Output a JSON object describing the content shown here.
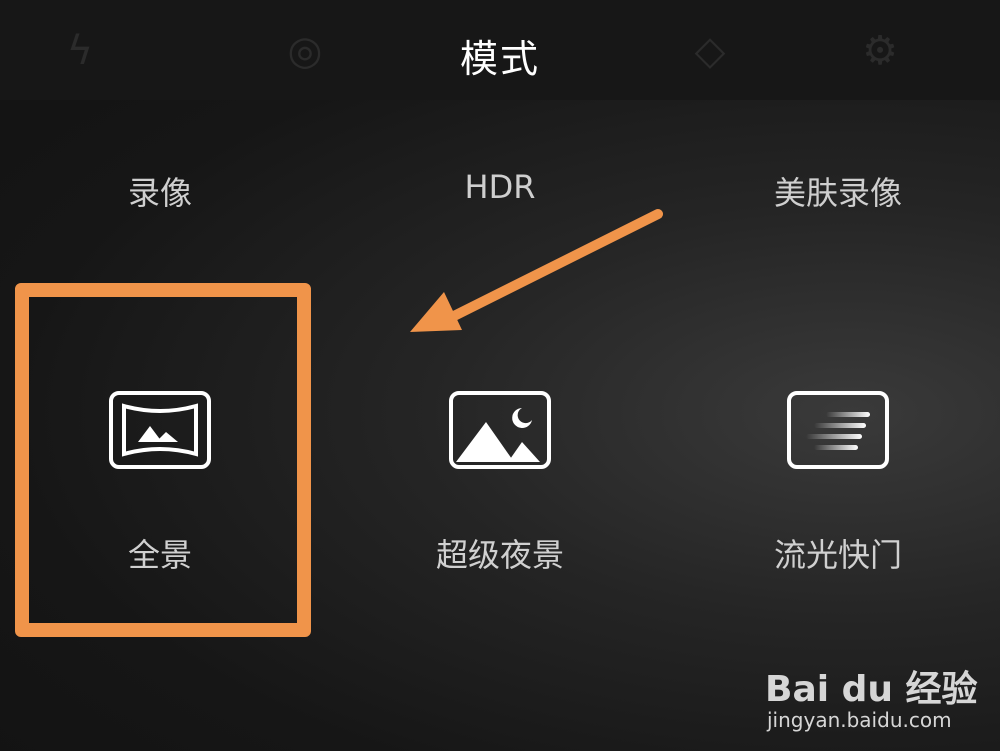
{
  "header": {
    "title": "模式",
    "background_icons": [
      "flash-icon",
      "timer-icon",
      "filter-icon",
      "settings-icon"
    ]
  },
  "modes_row1": [
    {
      "label": "录像"
    },
    {
      "label": "HDR"
    },
    {
      "label": "美肤录像"
    }
  ],
  "modes_row2": [
    {
      "label": "全景",
      "icon": "panorama-icon",
      "highlighted": true
    },
    {
      "label": "超级夜景",
      "icon": "night-scene-icon",
      "highlighted": false
    },
    {
      "label": "流光快门",
      "icon": "light-trail-icon",
      "highlighted": false
    }
  ],
  "annotation": {
    "highlight_color": "#f0944a",
    "arrow_color": "#f0944a"
  },
  "watermark": {
    "logo": "Bai du 经验",
    "url": "jingyan.baidu.com"
  }
}
